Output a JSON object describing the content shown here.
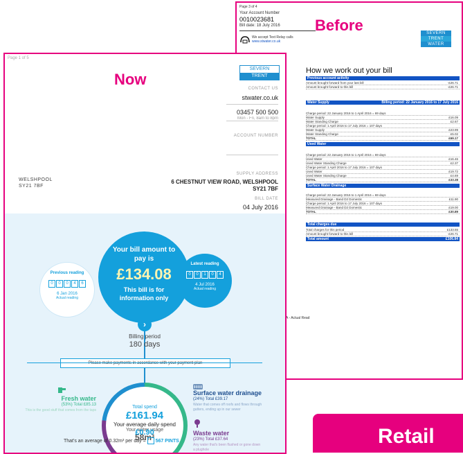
{
  "before": {
    "page": "Page 3 of 4",
    "account_label": "Your Account Number",
    "account_number": "0010023681",
    "bill_date": "Bill date: 18 July 2016",
    "text_relay": "We accept Text Relay calls",
    "website": "www.stwater.co.uk",
    "tag": "Before",
    "logo": [
      "SEVERN",
      "TRENT",
      "WATER"
    ],
    "heading": "How we work out your bill",
    "previous_activity_header": "Previous account activity",
    "prev_rows": [
      {
        "label": "Amount brought forward from your last bill",
        "value": "-£26.71"
      },
      {
        "label": "Amount brought forward to this bill",
        "value": "-£26.71"
      }
    ],
    "water_supply_header": "Water Supply",
    "water_supply_period": "Billing period: 22 January 2016 to 17 July 2016",
    "water_rows": [
      {
        "label": "Charge period: 22 January 2016 to 1 April 2016 = 69 days",
        "value": ""
      },
      {
        "label": "Water Supply",
        "value": "£16.09"
      },
      {
        "label": "Water Standing Charge",
        "value": "£2.67"
      },
      {
        "label": "Charge period: 1 April 2016 to 17 July 2016 = 107 days",
        "value": ""
      },
      {
        "label": "Water Supply",
        "value": "£23.99"
      },
      {
        "label": "Water Standing Charge",
        "value": "£5.02"
      },
      {
        "label": "TOTAL",
        "value": "£69.17"
      }
    ],
    "used_water_header": "Used Water",
    "used_rows": [
      {
        "label": "Charge period: 22 January 2016 to 1 April 2016 = 69 days",
        "value": ""
      },
      {
        "label": "Used Water",
        "value": "£16.46"
      },
      {
        "label": "Used Water Standing Charge",
        "value": "£2.37"
      },
      {
        "label": "Charge period: 1 April 2016 to 17 July 2016 = 107 days",
        "value": ""
      },
      {
        "label": "Used Water",
        "value": "£19.72"
      },
      {
        "label": "Used Water Standing Charge",
        "value": "£4.69"
      },
      {
        "label": "TOTAL",
        "value": "£33.38"
      }
    ],
    "surface_header": "Surface Water Drainage",
    "surface_rows": [
      {
        "label": "Charge period: 22 January 2016 to 1 April 2016 = 69 days",
        "value": ""
      },
      {
        "label": "Measured Drainage - Band D2  Domestic",
        "value": "£11.90"
      },
      {
        "label": "Charge period: 1 April 2016 to 17 July 2016 = 107 days",
        "value": ""
      },
      {
        "label": "Measured Drainage - Band D2  Domestic",
        "value": "£19.00"
      },
      {
        "label": "TOTAL",
        "value": "£30.89"
      }
    ],
    "total_header": "Total charges due",
    "total_rows": [
      {
        "label": "Total charges for this period",
        "value": "£133.55"
      },
      {
        "label": "Amount brought forward to this bill",
        "value": "-£26.71"
      },
      {
        "label": "Total amount",
        "value": "£106.84"
      }
    ],
    "footnote": "A - Actual Read"
  },
  "now": {
    "page": "Page 1 of 5",
    "tag": "Now",
    "logo": [
      "SEVERN",
      "TRENT"
    ],
    "contact_label": "CONTACT US",
    "website": "stwater.co.uk",
    "phone": "03457 500 500",
    "hours": "Mon - Fri, 8am to 8pm",
    "account_label": "ACCOUNT NUMBER",
    "supply_label": "SUPPLY ADDRESS",
    "address1": "6 CHESTNUT VIEW ROAD, WELSHPOOL",
    "address2": "SY21 7BF",
    "bill_date_label": "BILL DATE",
    "bill_date": "04 July 2016",
    "recipient_town": "WELSHPOOL",
    "recipient_postcode": "SY21 7BF",
    "bill_amount_text": "Your bill amount to pay is",
    "bill_amount": "£134.08",
    "info_only": "This bill is for information only",
    "previous_label": "Previous reading",
    "previous_digits": [
      "0",
      "0",
      "0",
      "4",
      "6"
    ],
    "previous_date": "6 Jan 2016",
    "previous_note": "Actual reading",
    "latest_label": "Latest reading",
    "latest_digits": [
      "0",
      "0",
      "1",
      "0",
      "4"
    ],
    "latest_date": "4 Jul 2016",
    "latest_note": "Actual reading",
    "billing_period_label": "Billing period",
    "billing_days": "180 days",
    "payment_note": "Please make payments in accordance with your payment plan",
    "fresh_title": "Fresh water",
    "fresh_sub": "(53%) Total £85.13",
    "fresh_desc": "This is the good stuff that comes from the taps",
    "total_spend_label": "Total spend",
    "total_spend": "£161.94",
    "usage_label": "Your water usage",
    "usage": "58m³",
    "surface_title": "Surface water drainage",
    "surface_sub": "(24%) Total £39.17",
    "surface_desc": "Water that comes off roofs and flows through gutters, ending up in our sewer",
    "waste_title": "Waste water",
    "waste_sub": "(23%) Total £37.64",
    "waste_desc": "Any water that's been flushed or gone down a plughole",
    "daily_label": "Your average daily spend",
    "daily_value": "£0.90",
    "average_text": "That's an average of 0.32m³ per day =",
    "pints": "567 PINTS"
  },
  "retail": "Retail",
  "colors": {
    "magenta": "#e6007e",
    "st_blue": "#1f8fcf",
    "bill_blue": "#1254c4",
    "green": "#35b88a",
    "purple": "#7a3b8f"
  }
}
